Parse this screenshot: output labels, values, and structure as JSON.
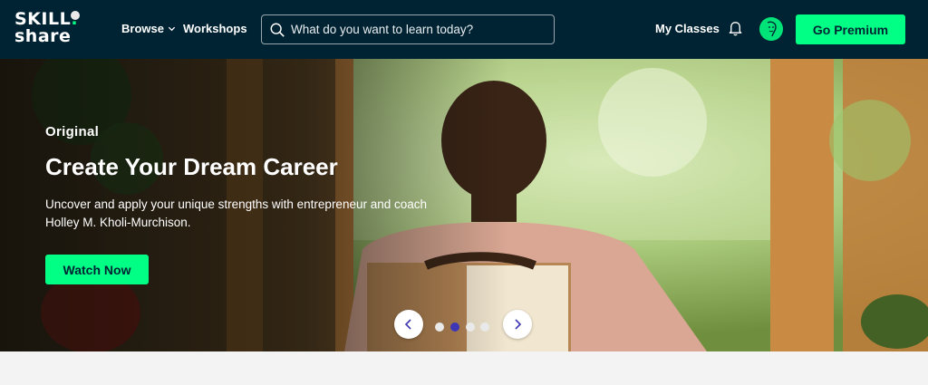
{
  "brand": {
    "line1": "SKILL",
    "line2": "share",
    "dot": ".",
    "accent": "#00ff84",
    "nav_bg": "#002333"
  },
  "nav": {
    "browse_label": "Browse",
    "workshops_label": "Workshops",
    "my_classes_label": "My Classes",
    "premium_label": "Go Premium"
  },
  "search": {
    "placeholder": "What do you want to learn today?",
    "value": ""
  },
  "hero": {
    "badge": "Original",
    "title": "Create Your Dream Career",
    "subtitle": "Uncover and apply your unique strengths with entrepreneur and coach Holley M. Kholi-Murchison.",
    "cta_label": "Watch Now"
  },
  "carousel": {
    "slide_count": 4,
    "active_index": 1,
    "active_color": "#3d37b5"
  },
  "icons": {
    "search": "search-icon",
    "chevron": "chevron-down-icon",
    "bell": "bell-icon",
    "prev": "chevron-left-icon",
    "next": "chevron-right-icon"
  }
}
